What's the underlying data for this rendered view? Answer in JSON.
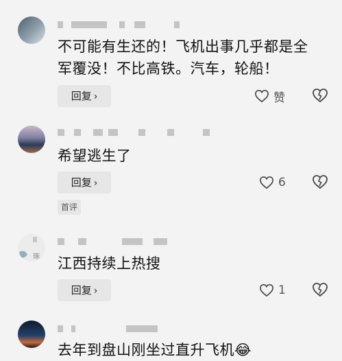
{
  "comments": [
    {
      "text_line1": "不可能有生还的！飞机出事几乎都是全",
      "text_line2": "军覆没！不比高铁。汽车，轮船！",
      "reply_label": "回复",
      "like_label": "赞",
      "avatar_colors": [
        "#5a6c7a",
        "#c9d4dc"
      ]
    },
    {
      "text_line1": "希望逃生了",
      "reply_label": "回复",
      "like_count": "6",
      "badge": "首评",
      "avatar_colors": [
        "#3b4b66",
        "#b98a6c"
      ]
    },
    {
      "text_line1": "江西持续上热搜",
      "reply_label": "回复",
      "like_count": "1",
      "avatar_colors": [
        "#e6e6e6",
        "#7a9aa8"
      ]
    },
    {
      "text_line1": "去年到盘山刚坐过直升飞机",
      "emoji": "😂",
      "avatar_colors": [
        "#1f3147",
        "#d46a3c"
      ]
    }
  ]
}
